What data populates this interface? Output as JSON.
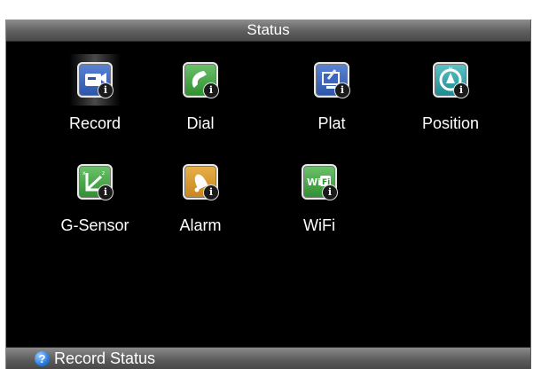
{
  "window": {
    "title": "Status"
  },
  "items": [
    {
      "label": "Record",
      "icon": "record-icon",
      "color": "#2c54a8",
      "selected": true
    },
    {
      "label": "Dial",
      "icon": "phone-icon",
      "color": "#2f8f2f"
    },
    {
      "label": "Plat",
      "icon": "plat-icon",
      "color": "#2c54a8"
    },
    {
      "label": "Position",
      "icon": "compass-icon",
      "color": "#1f8a8f"
    },
    {
      "label": "G-Sensor",
      "icon": "g-sensor-icon",
      "color": "#2f8f2f"
    },
    {
      "label": "Alarm",
      "icon": "bell-icon",
      "color": "#c8861c"
    },
    {
      "label": "WiFi",
      "icon": "wifi-icon",
      "color": "#2f8f2f"
    }
  ],
  "badge_glyph": "i",
  "statusbar": {
    "help_glyph": "?",
    "text": "Record Status"
  }
}
